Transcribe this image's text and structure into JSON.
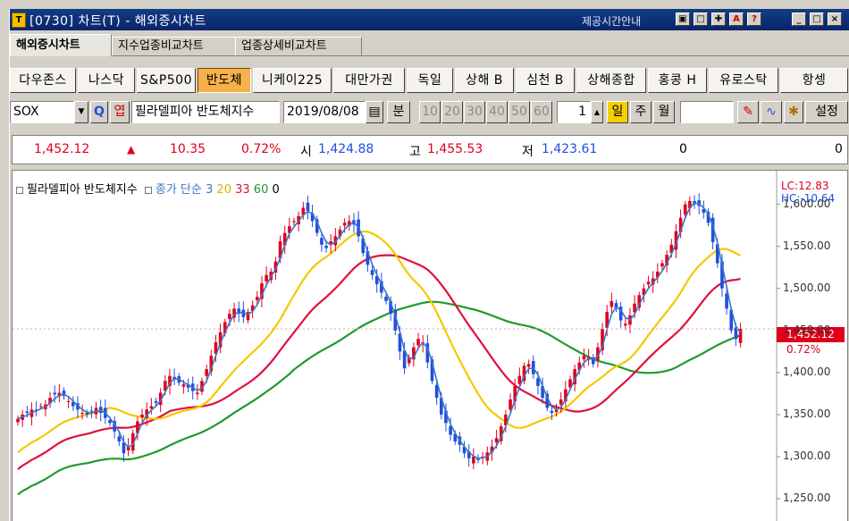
{
  "window": {
    "title": "[0730] 차트(T) - 해외증시차트",
    "service_link": "제공시간안내",
    "app_icon": "T",
    "title_buttons": [
      "layout-icon",
      "restore-icon",
      "pin-icon",
      "excel-icon",
      "help-icon",
      "minimize-icon",
      "maximize-icon",
      "close-icon"
    ]
  },
  "tabs": [
    {
      "label": "해외증시차트",
      "active": true
    },
    {
      "label": "지수업종비교차트",
      "active": false
    },
    {
      "label": "업종상세비교차트",
      "active": false
    }
  ],
  "markets": [
    "다우존스",
    "나스닥",
    "S&P500",
    "반도체",
    "니케이225",
    "대만가권",
    "독일",
    "상해 B",
    "심천 B",
    "상해종합",
    "홍콩 H",
    "유로스탁",
    "항셍"
  ],
  "active_market": "반도체",
  "toolbar": {
    "symbol": "SOX",
    "search_label": "Q",
    "hint_label": "엽",
    "name": "필라델피아 반도체지수",
    "date": "2019/08/08",
    "period_button": "분",
    "minute_options": [
      "10",
      "20",
      "30",
      "40",
      "50",
      "60"
    ],
    "count_value": "1",
    "day_button": "일",
    "week_button": "주",
    "month_button": "월",
    "settings_label": "설정"
  },
  "quote": {
    "last": "1,452.12",
    "change_arrow": "▲",
    "change": "10.35",
    "change_pct": "0.72%",
    "open_label": "시",
    "open": "1,424.88",
    "high_label": "고",
    "high": "1,455.53",
    "low_label": "저",
    "low": "1,423.61",
    "volume": "0",
    "extra": "0"
  },
  "legend": {
    "name": "필라델피아 반도체지수",
    "ma_label": "종가 단순",
    "ma_periods": [
      "3",
      "20",
      "33",
      "60",
      "0"
    ]
  },
  "right_info": {
    "lc": "LC:12.83",
    "hc": "HC:-10.64",
    "price": "1,452.12",
    "pct": "0.72%"
  },
  "colors": {
    "up": "#e0001b",
    "down": "#1f4fe0",
    "ma3": "#3a76c8",
    "ma20": "#f5c800",
    "ma33": "#e0103c",
    "ma60": "#1f9a2e",
    "accent": "#f5b14a"
  },
  "chart_data": {
    "type": "candlestick",
    "y_ticks": [
      1250,
      1300,
      1350,
      1400,
      1450,
      1500,
      1550,
      1600
    ],
    "y_tick_labels": [
      "1,250.00",
      "1,300.00",
      "1,350.00",
      "1,400.00",
      "1,450.00",
      "1,500.00",
      "1,550.00",
      "1,600.00"
    ],
    "ylim": [
      1215,
      1640
    ],
    "close": [
      1345,
      1350,
      1352,
      1356,
      1355,
      1360,
      1362,
      1370,
      1374,
      1376,
      1372,
      1366,
      1360,
      1356,
      1352,
      1350,
      1354,
      1358,
      1352,
      1346,
      1340,
      1330,
      1318,
      1304,
      1312,
      1328,
      1342,
      1350,
      1356,
      1360,
      1364,
      1376,
      1390,
      1396,
      1392,
      1388,
      1386,
      1382,
      1378,
      1376,
      1390,
      1404,
      1420,
      1436,
      1448,
      1460,
      1470,
      1476,
      1470,
      1466,
      1472,
      1480,
      1490,
      1506,
      1516,
      1520,
      1532,
      1556,
      1566,
      1574,
      1580,
      1586,
      1596,
      1592,
      1580,
      1566,
      1552,
      1548,
      1556,
      1562,
      1570,
      1578,
      1580,
      1576,
      1562,
      1542,
      1528,
      1516,
      1505,
      1495,
      1485,
      1470,
      1450,
      1425,
      1405,
      1418,
      1430,
      1440,
      1436,
      1412,
      1390,
      1370,
      1350,
      1340,
      1326,
      1318,
      1314,
      1304,
      1298,
      1300,
      1296,
      1300,
      1305,
      1312,
      1322,
      1336,
      1350,
      1368,
      1384,
      1396,
      1408,
      1410,
      1398,
      1384,
      1370,
      1358,
      1352,
      1356,
      1368,
      1380,
      1392,
      1404,
      1412,
      1420,
      1418,
      1410,
      1430,
      1452,
      1472,
      1485,
      1476,
      1462,
      1458,
      1468,
      1482,
      1492,
      1500,
      1508,
      1512,
      1520,
      1530,
      1540,
      1552,
      1568,
      1584,
      1600,
      1604,
      1600,
      1598,
      1590,
      1578,
      1555,
      1530,
      1500,
      1476,
      1450,
      1440,
      1452
    ]
  }
}
